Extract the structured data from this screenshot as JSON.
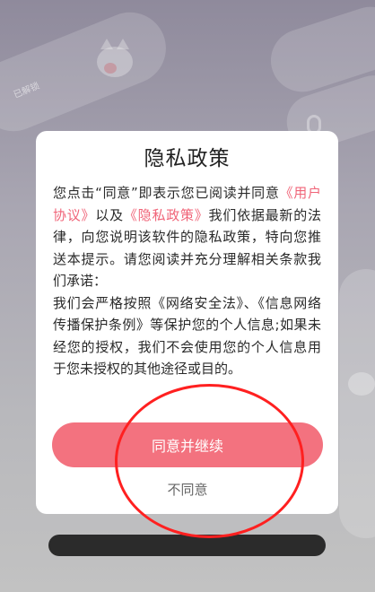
{
  "background": {
    "badge_text": "已解锁"
  },
  "dialog": {
    "title": "隐私政策",
    "body_part_1": "您点击“同意”即表示您已阅读并同意",
    "link_user_agreement": "《用户协议》",
    "body_part_2": "以及",
    "link_privacy_policy": "《隐私政策》",
    "body_part_3": "我们依据最新的法律，向您说明该软件的隐私政策，特向您推送本提示。请您阅读并充分理解相关条款我们承诺：",
    "body_part_4": "我们会严格按照《网络安全法》、《信息网络传播保护条例》等保护您的个人信息;如果未经您的授权，我们不会使用您的个人信息用于您未授权的其他途径或目的。",
    "agree_label": "同意并继续",
    "disagree_label": "不同意"
  },
  "colors": {
    "accent": "#f3727f",
    "link": "#f06478",
    "annotation": "#ff2020"
  }
}
